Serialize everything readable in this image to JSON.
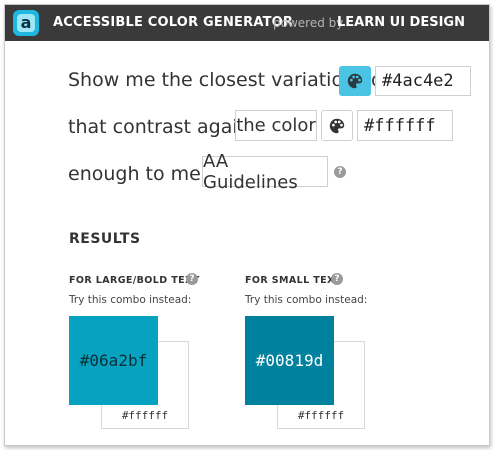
{
  "header": {
    "logo_letter": "a",
    "title": "ACCESSIBLE COLOR GENERATOR",
    "powered_by": "powered by",
    "brand": "LEARN UI DESIGN"
  },
  "form": {
    "line1_text": "Show me the closest variations of",
    "color_value": "#4ac4e2",
    "line2_text": "that contrast against",
    "contrast_target": "the color",
    "background_value": "#ffffff",
    "line3_text": "enough to meet",
    "guideline": "AA Guidelines"
  },
  "results": {
    "heading": "RESULTS",
    "large": {
      "label": "FOR LARGE/BOLD TEXT",
      "hint": "Try this combo instead:",
      "fg": "#06a2bf",
      "bg": "#ffffff"
    },
    "small": {
      "label": "FOR SMALL TEXT",
      "hint": "Try this combo instead:",
      "fg": "#00819d",
      "bg": "#ffffff"
    }
  },
  "colors": {
    "input_swatch": "#4ac4e2",
    "large_swatch": "#06a2bf",
    "small_swatch": "#00819d",
    "header_bg": "#3a3a3a"
  }
}
